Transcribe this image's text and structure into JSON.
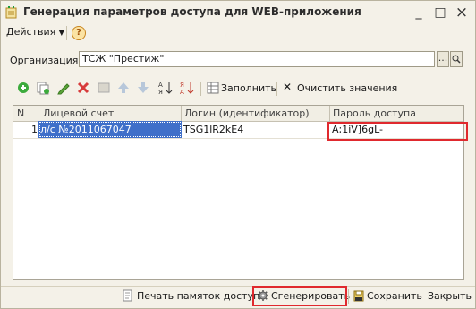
{
  "window": {
    "title": "Генерация параметров доступа для WEB-приложения",
    "controls": {
      "minimize": "_",
      "maximize": "□",
      "close": "×"
    }
  },
  "menu": {
    "actions_label": "Действия",
    "help_label": "?"
  },
  "organization": {
    "label": "Организация:",
    "value": "ТСЖ \"Престиж\"",
    "select_button": "...",
    "open_button": "Q"
  },
  "toolbar": {
    "fill_label": "Заполнить",
    "clear_label": "Очистить значения",
    "icons": [
      "add-icon",
      "copy-icon",
      "edit-icon",
      "delete-icon",
      "end-edit-icon",
      "move-up-icon",
      "move-down-icon",
      "sort-asc-icon",
      "sort-desc-icon",
      "fill-icon",
      "clear-icon"
    ]
  },
  "table": {
    "columns": [
      "N",
      "Лицевой счет",
      "Логин (идентификатор)",
      "Пароль доступа"
    ],
    "rows": [
      {
        "n": "1",
        "account": "л/с №2011067047",
        "login": "TSG1lR2kE4",
        "password": "A;1iV]6gL-"
      }
    ]
  },
  "footer": {
    "print_label": "Печать памяток доступа",
    "generate_label": "Сгенерировать",
    "save_label": "Сохранить",
    "close_label": "Закрыть"
  },
  "highlight_color": "#e0292e",
  "selection_color": "#3f6fc9"
}
